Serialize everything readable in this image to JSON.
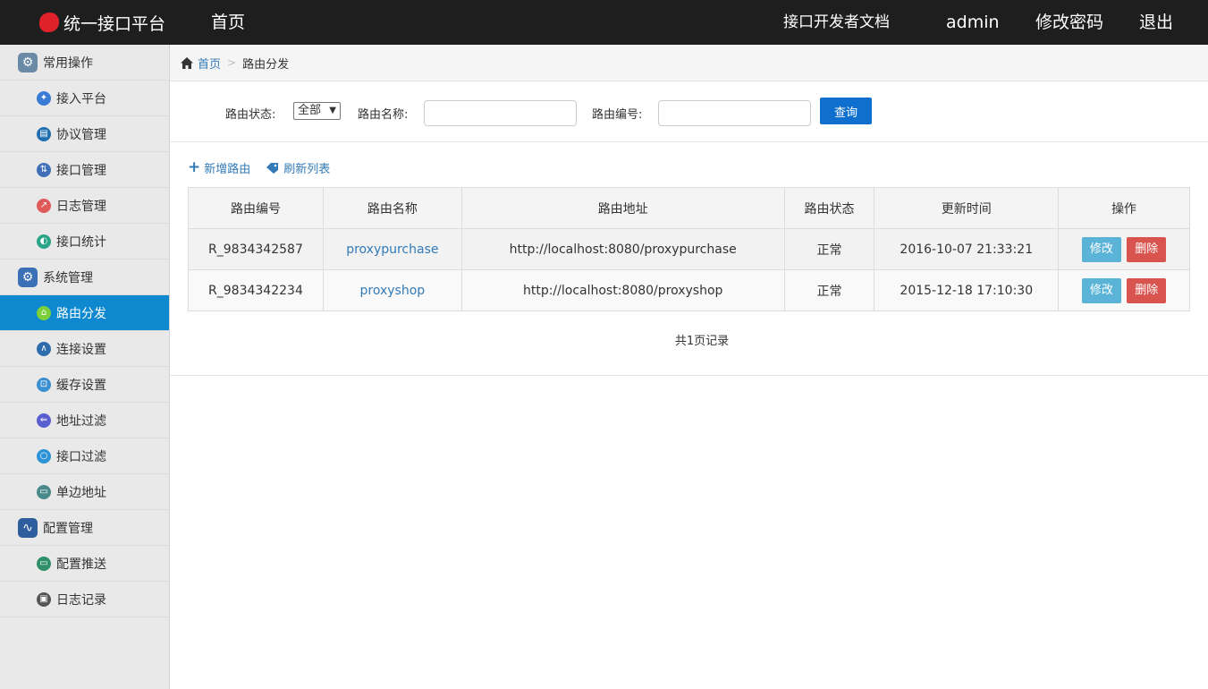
{
  "header": {
    "brand": "统一接口平台",
    "home": "首页",
    "docs": "接口开发者文档",
    "user": "admin",
    "change_password": "修改密码",
    "logout": "退出"
  },
  "sidebar": {
    "items": [
      {
        "label": "常用操作",
        "type": "group",
        "icon": "gear-icon",
        "color": "#6a8aa6"
      },
      {
        "label": "接入平台",
        "type": "sub",
        "icon": "accessibility-icon",
        "color": "#3a7bd5"
      },
      {
        "label": "协议管理",
        "type": "sub",
        "icon": "document-icon",
        "color": "#1f6fb0"
      },
      {
        "label": "接口管理",
        "type": "sub",
        "icon": "transfer-icon",
        "color": "#3f6fb8"
      },
      {
        "label": "日志管理",
        "type": "sub",
        "icon": "chart-icon",
        "color": "#e05a5a"
      },
      {
        "label": "接口统计",
        "type": "sub",
        "icon": "leaf-icon",
        "color": "#2aa58a"
      },
      {
        "label": "系统管理",
        "type": "group",
        "icon": "settings-icon",
        "color": "#3b6fb6"
      },
      {
        "label": "路由分发",
        "type": "sub",
        "icon": "route-icon",
        "color": "#7ccf3a",
        "active": true
      },
      {
        "label": "连接设置",
        "type": "sub",
        "icon": "connect-icon",
        "color": "#2f6cae"
      },
      {
        "label": "缓存设置",
        "type": "sub",
        "icon": "cache-icon",
        "color": "#3a8fd0"
      },
      {
        "label": "地址过滤",
        "type": "sub",
        "icon": "filter-icon",
        "color": "#5a5fcf"
      },
      {
        "label": "接口过滤",
        "type": "sub",
        "icon": "ring-icon",
        "color": "#2c93d6"
      },
      {
        "label": "单边地址",
        "type": "sub",
        "icon": "monitor-icon",
        "color": "#4a8a8a"
      },
      {
        "label": "配置管理",
        "type": "group",
        "icon": "waveform-icon",
        "color": "#2f5e9e"
      },
      {
        "label": "配置推送",
        "type": "sub",
        "icon": "screen-icon",
        "color": "#2f8f6a"
      },
      {
        "label": "日志记录",
        "type": "sub",
        "icon": "storage-icon",
        "color": "#555555"
      }
    ]
  },
  "breadcrumb": {
    "home": "首页",
    "current": "路由分发"
  },
  "filter": {
    "status_label": "路由状态:",
    "status_value": "全部",
    "name_label": "路由名称:",
    "name_value": "",
    "code_label": "路由编号:",
    "code_value": "",
    "query_button": "查询"
  },
  "actions": {
    "add": "新增路由",
    "refresh": "刷新列表"
  },
  "table": {
    "columns": [
      "路由编号",
      "路由名称",
      "路由地址",
      "路由状态",
      "更新时间",
      "操作"
    ],
    "rows": [
      {
        "code": "R_9834342587",
        "name": "proxypurchase",
        "url": "http://localhost:8080/proxypurchase",
        "status": "正常",
        "updated": "2016-10-07 21:33:21"
      },
      {
        "code": "R_9834342234",
        "name": "proxyshop",
        "url": "http://localhost:8080/proxyshop",
        "status": "正常",
        "updated": "2015-12-18 17:10:30"
      }
    ],
    "edit_label": "修改",
    "delete_label": "删除"
  },
  "pager": {
    "text": "共1页记录"
  }
}
